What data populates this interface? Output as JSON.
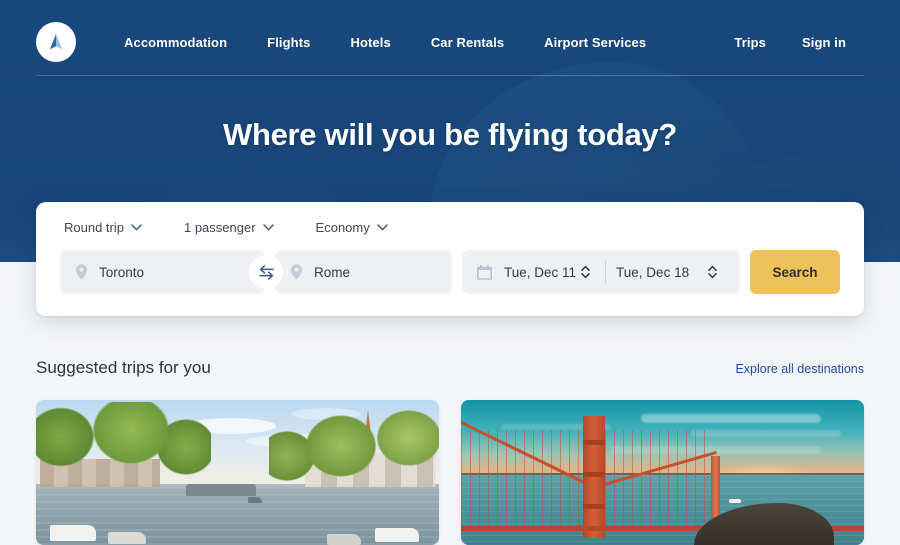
{
  "brand": {
    "logo_icon": "triangle-arrow-logo"
  },
  "nav": {
    "links": [
      {
        "label": "Accommodation"
      },
      {
        "label": "Flights"
      },
      {
        "label": "Hotels"
      },
      {
        "label": "Car Rentals"
      },
      {
        "label": "Airport Services"
      }
    ],
    "right_links": [
      {
        "label": "Trips"
      },
      {
        "label": "Sign in"
      }
    ]
  },
  "hero": {
    "headline": "Where will you be flying today?"
  },
  "search": {
    "trip_type": "Round trip",
    "passengers": "1 passenger",
    "cabin_class": "Economy",
    "origin": "Toronto",
    "destination": "Rome",
    "depart_date": "Tue, Dec 11",
    "return_date": "Tue, Dec 18",
    "search_label": "Search",
    "icons": {
      "origin_icon": "location-pin-icon",
      "destination_icon": "location-pin-icon",
      "swap_icon": "swap-arrows-icon",
      "calendar_icon": "calendar-icon",
      "stepper_icon": "chevron-up-down-icon",
      "dropdown_icon": "chevron-down-icon"
    }
  },
  "suggested": {
    "title": "Suggested trips for you",
    "explore_link": "Explore all destinations",
    "cards": [
      {
        "image_alt": "Amsterdam canal with trees, houses and boats"
      },
      {
        "image_alt": "Golden Gate Bridge at sunset over the bay"
      }
    ]
  },
  "colors": {
    "hero_blue": "#1b4a80",
    "accent_yellow": "#eec25b",
    "link_blue": "#1b4f9b",
    "field_gray": "#eef0f4",
    "page_bg": "#f4f5f7"
  }
}
